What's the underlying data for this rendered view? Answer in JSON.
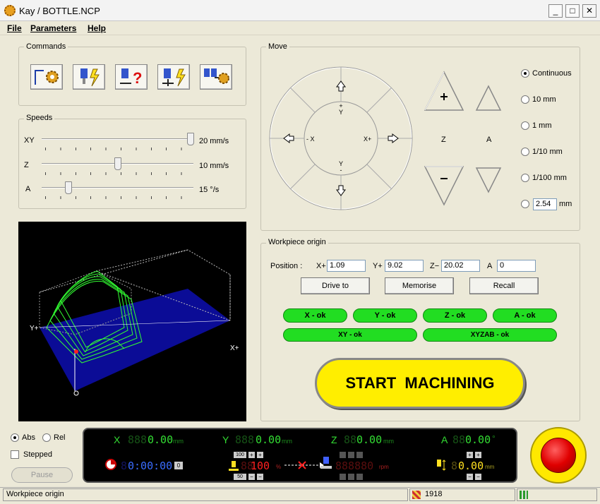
{
  "window": {
    "title": "Kay / BOTTLE.NCP",
    "minimize": "_",
    "maximize": "□",
    "close": "✕"
  },
  "menu": {
    "file": "File",
    "parameters": "Parameters",
    "help": "Help"
  },
  "commands": {
    "label": "Commands"
  },
  "speeds": {
    "label": "Speeds",
    "xy_label": "XY",
    "xy_value": "20 mm/s",
    "xy_level": 1.0,
    "z_label": "Z",
    "z_value": "10 mm/s",
    "z_level": 0.5,
    "a_label": "A",
    "a_value": "15 °/s",
    "a_level": 0.16
  },
  "move": {
    "label": "Move",
    "minus_x": "- X",
    "plus_x": "X+",
    "plus_y": "+\nY",
    "minus_y": "Y\n-",
    "z_label": "Z",
    "a_label": "A",
    "steps": [
      "Continuous",
      "10 mm",
      "1 mm",
      "1/10 mm",
      "1/100 mm"
    ],
    "custom_value": "2.54",
    "custom_unit": "mm"
  },
  "workpiece": {
    "label": "Workpiece origin",
    "position_label": "Position :",
    "x_label": "X+",
    "x_value": "1.09",
    "y_label": "Y+",
    "y_value": "9.02",
    "z_label": "Z−",
    "z_value": "20.02",
    "a_label": "A",
    "a_value": "0",
    "drive_to": "Drive to",
    "memorise": "Memorise",
    "recall": "Recall",
    "x_ok": "X - ok",
    "y_ok": "Y - ok",
    "z_ok": "Z - ok",
    "a_ok": "A - ok",
    "xy_ok": "XY - ok",
    "xyzab_ok": "XYZAB - ok"
  },
  "start": "START  MACHINING",
  "preview": {
    "y_axis": "Y+",
    "x_axis": "X+"
  },
  "coords": {
    "abs": "Abs",
    "rel": "Rel",
    "stepped": "Stepped",
    "pause": "Pause"
  },
  "readout": {
    "x_label": "X",
    "x_dim": "888",
    "x_value": "0.00",
    "y_label": "Y",
    "y_dim": "888",
    "y_value": "0.00",
    "z_label": "Z",
    "z_dim": "88",
    "z_value": "0.00",
    "a_label": "A",
    "a_dim": "88",
    "a_value": "0.00",
    "unit_mm": "mm",
    "unit_deg": "°",
    "time_dim": "8",
    "time": "0:00:00",
    "feed_top": "100",
    "feed_bottom": "50",
    "feed_dim": "88",
    "feed_value": "100",
    "feed_unit": "%",
    "rpm_value": "888880",
    "rpm_unit": "rpm",
    "z_offset_dim": "8",
    "z_offset": "0.00",
    "z_offset_unit": "mm"
  },
  "statusbar": {
    "text": "Workpiece origin",
    "count": "1918"
  }
}
